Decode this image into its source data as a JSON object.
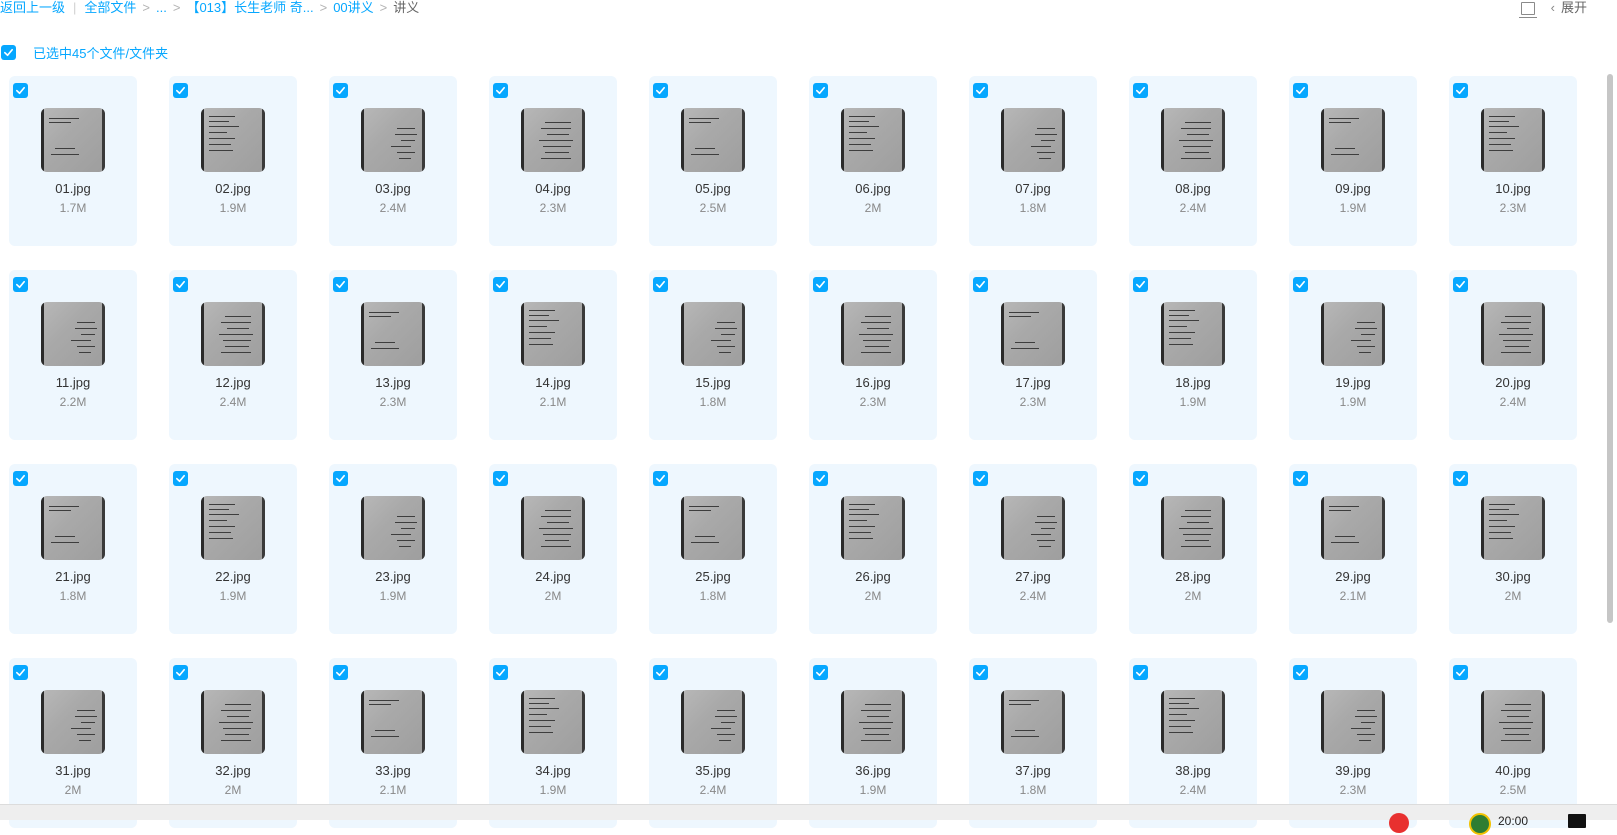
{
  "breadcrumb": {
    "back": "返回上一级",
    "items": [
      "全部文件",
      "...",
      "【013】长生老师 奇...",
      "00讲义"
    ],
    "current": "讲义"
  },
  "top_right": {
    "expand_label": "展开"
  },
  "selection": {
    "label": "已选中45个文件/文件夹"
  },
  "files": [
    {
      "name": "01.jpg",
      "size": "1.7M"
    },
    {
      "name": "02.jpg",
      "size": "1.9M"
    },
    {
      "name": "03.jpg",
      "size": "2.4M"
    },
    {
      "name": "04.jpg",
      "size": "2.3M"
    },
    {
      "name": "05.jpg",
      "size": "2.5M"
    },
    {
      "name": "06.jpg",
      "size": "2M"
    },
    {
      "name": "07.jpg",
      "size": "1.8M"
    },
    {
      "name": "08.jpg",
      "size": "2.4M"
    },
    {
      "name": "09.jpg",
      "size": "1.9M"
    },
    {
      "name": "10.jpg",
      "size": "2.3M"
    },
    {
      "name": "11.jpg",
      "size": "2.2M"
    },
    {
      "name": "12.jpg",
      "size": "2.4M"
    },
    {
      "name": "13.jpg",
      "size": "2.3M"
    },
    {
      "name": "14.jpg",
      "size": "2.1M"
    },
    {
      "name": "15.jpg",
      "size": "1.8M"
    },
    {
      "name": "16.jpg",
      "size": "2.3M"
    },
    {
      "name": "17.jpg",
      "size": "2.3M"
    },
    {
      "name": "18.jpg",
      "size": "1.9M"
    },
    {
      "name": "19.jpg",
      "size": "1.9M"
    },
    {
      "name": "20.jpg",
      "size": "2.4M"
    },
    {
      "name": "21.jpg",
      "size": "1.8M"
    },
    {
      "name": "22.jpg",
      "size": "1.9M"
    },
    {
      "name": "23.jpg",
      "size": "1.9M"
    },
    {
      "name": "24.jpg",
      "size": "2M"
    },
    {
      "name": "25.jpg",
      "size": "1.8M"
    },
    {
      "name": "26.jpg",
      "size": "2M"
    },
    {
      "name": "27.jpg",
      "size": "2.4M"
    },
    {
      "name": "28.jpg",
      "size": "2M"
    },
    {
      "name": "29.jpg",
      "size": "2.1M"
    },
    {
      "name": "30.jpg",
      "size": "2M"
    },
    {
      "name": "31.jpg",
      "size": "2M"
    },
    {
      "name": "32.jpg",
      "size": "2M"
    },
    {
      "name": "33.jpg",
      "size": "2.1M"
    },
    {
      "name": "34.jpg",
      "size": "1.9M"
    },
    {
      "name": "35.jpg",
      "size": "2.4M"
    },
    {
      "name": "36.jpg",
      "size": "1.9M"
    },
    {
      "name": "37.jpg",
      "size": "1.8M"
    },
    {
      "name": "38.jpg",
      "size": "2.4M"
    },
    {
      "name": "39.jpg",
      "size": "2.3M"
    },
    {
      "name": "40.jpg",
      "size": "2.5M"
    }
  ],
  "taskbar": {
    "time": "20:00"
  },
  "colors": {
    "accent": "#06a7ff",
    "card_bg": "#eef7fe"
  }
}
